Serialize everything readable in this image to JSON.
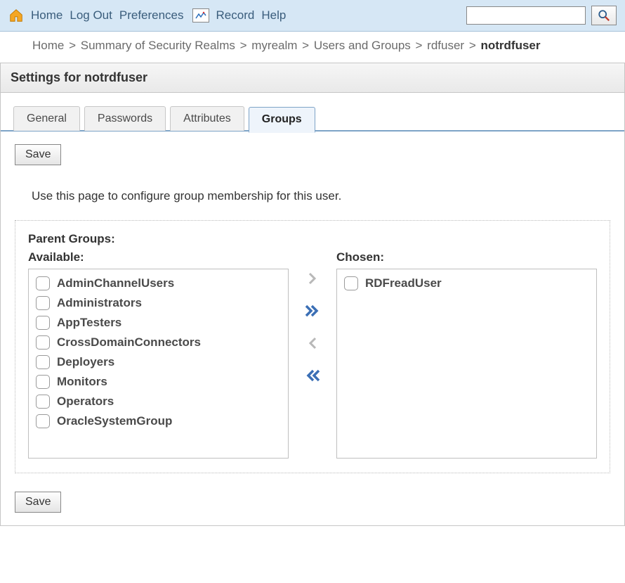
{
  "topbar": {
    "home": "Home",
    "logout": "Log Out",
    "preferences": "Preferences",
    "record": "Record",
    "help": "Help"
  },
  "breadcrumb": {
    "items": [
      "Home",
      "Summary of Security Realms",
      "myrealm",
      "Users and Groups",
      "rdfuser"
    ],
    "current": "notrdfuser"
  },
  "panel": {
    "title": "Settings for notrdfuser"
  },
  "tabs": [
    {
      "label": "General",
      "active": false
    },
    {
      "label": "Passwords",
      "active": false
    },
    {
      "label": "Attributes",
      "active": false
    },
    {
      "label": "Groups",
      "active": true
    }
  ],
  "buttons": {
    "save": "Save"
  },
  "description": "Use this page to configure group membership for this user.",
  "groups": {
    "parent_label": "Parent Groups:",
    "available_label": "Available:",
    "chosen_label": "Chosen:",
    "available": [
      "AdminChannelUsers",
      "Administrators",
      "AppTesters",
      "CrossDomainConnectors",
      "Deployers",
      "Monitors",
      "Operators",
      "OracleSystemGroup"
    ],
    "chosen": [
      "RDFreadUser"
    ]
  }
}
